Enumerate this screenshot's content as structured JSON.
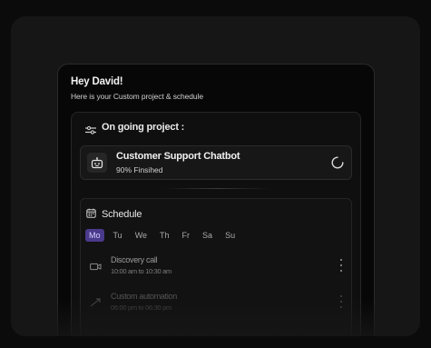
{
  "header": {
    "greeting": "Hey David!",
    "subtitle": "Here is your Custom project & schedule"
  },
  "ongoing": {
    "title": "On going project :",
    "project": {
      "name": "Customer Support Chatbot",
      "progress_text": "90% Finsihed"
    }
  },
  "schedule": {
    "title": "Schedule",
    "days": [
      "Mo",
      "Tu",
      "We",
      "Th",
      "Fr",
      "Sa",
      "Su"
    ],
    "active_day_index": 0,
    "events": [
      {
        "title": "Discovery call",
        "time": "10:00 am to 10:30 am",
        "icon": "video-camera-icon"
      },
      {
        "title": "Custom automation",
        "time": "06:00 pm to 06:30 pm",
        "icon": "link-arrow-icon"
      }
    ]
  },
  "colors": {
    "accent": "#4a3a8c",
    "background": "#0b0b0b",
    "card": "#070707"
  }
}
